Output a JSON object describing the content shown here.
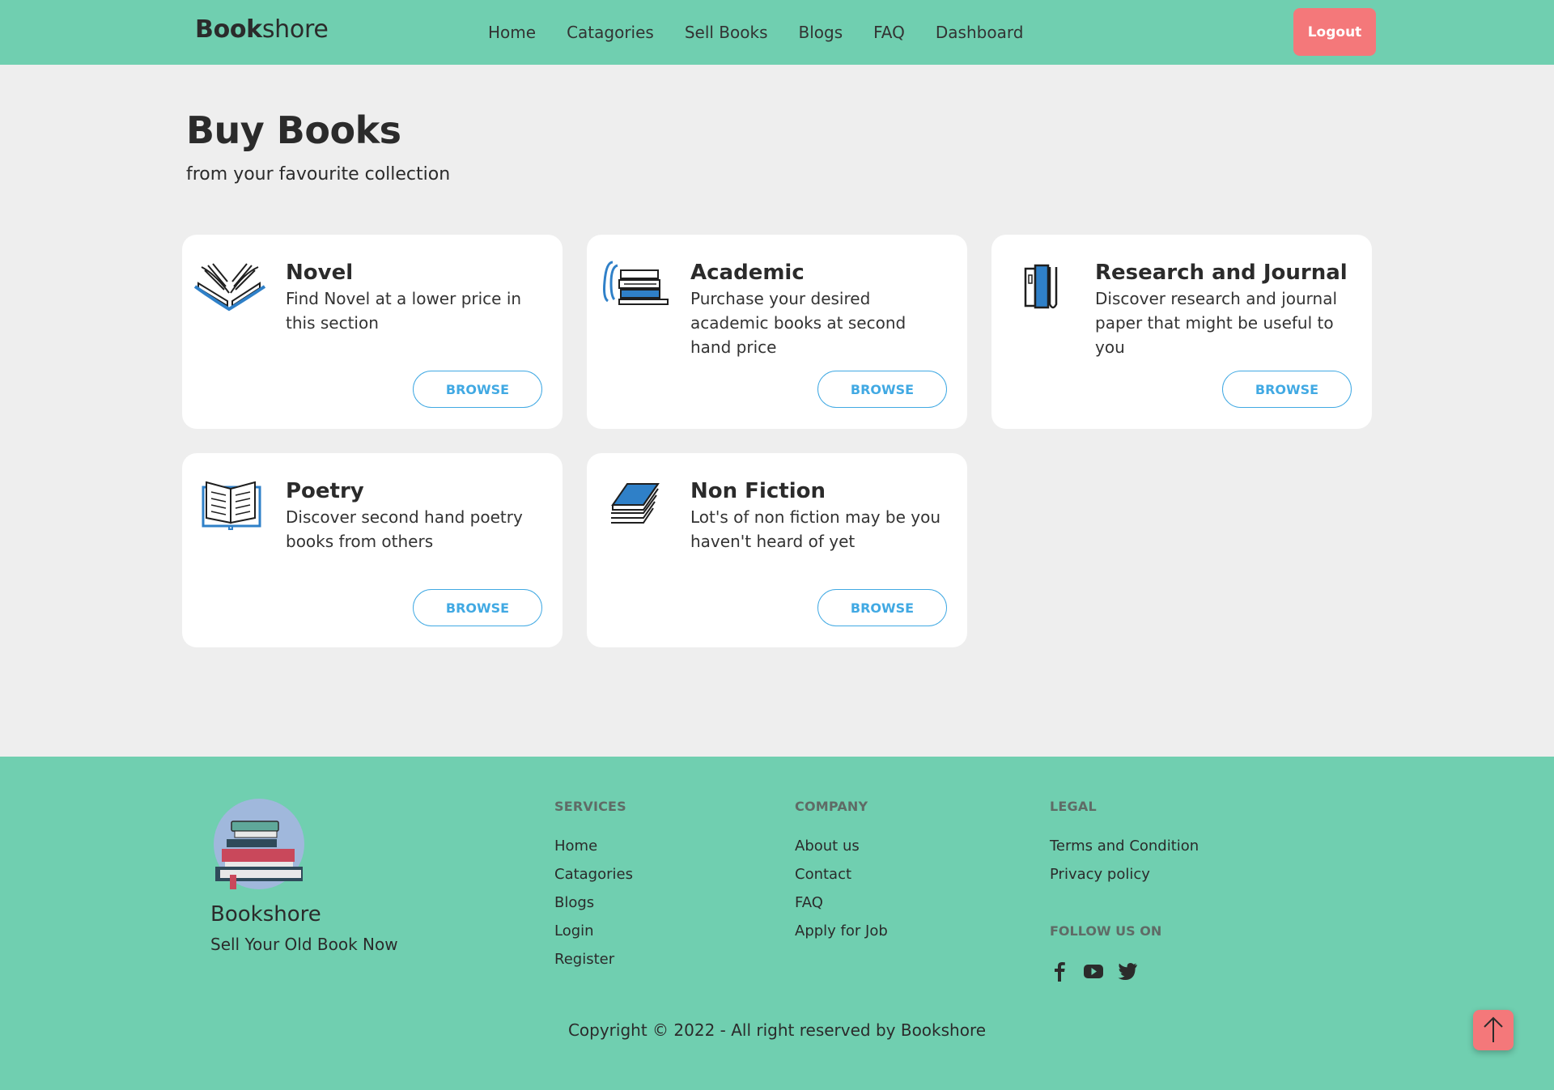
{
  "nav": {
    "brand_bold": "Book",
    "brand_rest": "shore",
    "links": [
      "Home",
      "Catagories",
      "Sell Books",
      "Blogs",
      "FAQ",
      "Dashboard"
    ],
    "logout_label": "Logout",
    "bg_color": "#70cfb0",
    "logout_color": "#f4787a"
  },
  "main": {
    "title": "Buy Books",
    "subtitle": "from your favourite collection",
    "cards": [
      {
        "title": "Novel",
        "desc": "Find Novel at a lower price in this section",
        "button": "BROWSE",
        "icon": "open-book-icon"
      },
      {
        "title": "Academic",
        "desc": "Purchase your desired academic books at second hand price",
        "button": "BROWSE",
        "icon": "book-stack-icon"
      },
      {
        "title": "Research and Journal",
        "desc": "Discover research and journal paper that might be useful to you",
        "button": "BROWSE",
        "icon": "standing-books-icon"
      },
      {
        "title": "Poetry",
        "desc": "Discover second hand poetry books from others",
        "button": "BROWSE",
        "icon": "reading-book-icon"
      },
      {
        "title": "Non Fiction",
        "desc": "Lot's of non fiction may be you haven't heard of yet",
        "button": "BROWSE",
        "icon": "blue-book-stack-icon"
      }
    ]
  },
  "footer": {
    "brand": "Bookshore",
    "tagline": "Sell Your Old Book Now",
    "services": {
      "heading": "SERVICES",
      "links": [
        "Home",
        "Catagories",
        "Blogs",
        "Login",
        "Register"
      ]
    },
    "company": {
      "heading": "COMPANY",
      "links": [
        "About us",
        "Contact",
        "FAQ",
        "Apply for Job"
      ]
    },
    "legal": {
      "heading": "LEGAL",
      "links": [
        "Terms and Condition",
        "Privacy policy"
      ]
    },
    "follow_heading": "FOLLOW US ON",
    "social_icons": [
      "facebook-icon",
      "youtube-icon",
      "twitter-icon"
    ],
    "copyright": "Copyright © 2022 - All right reserved by Bookshore"
  }
}
